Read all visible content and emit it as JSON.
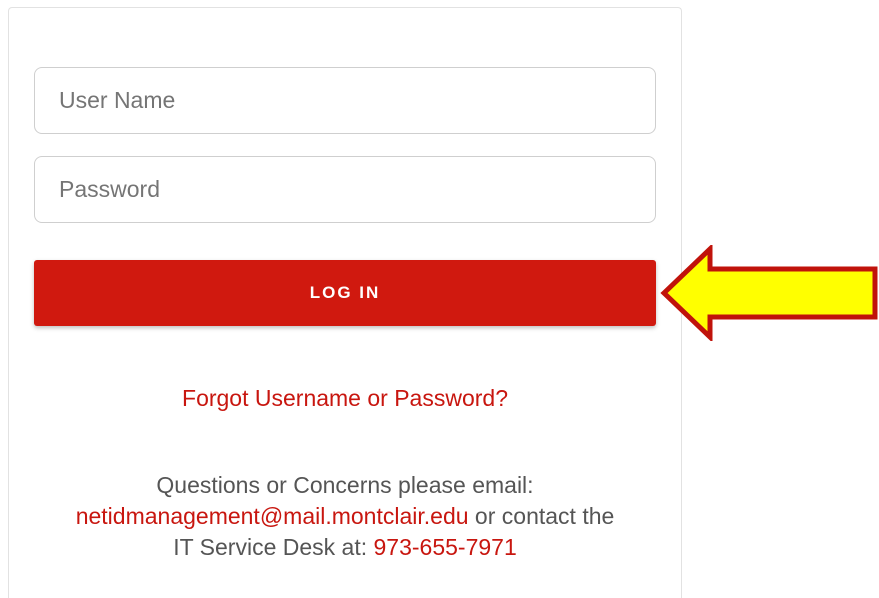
{
  "form": {
    "username_placeholder": "User Name",
    "password_placeholder": "Password",
    "login_label": "LOG IN",
    "forgot_label": "Forgot Username or Password?"
  },
  "contact": {
    "line1": "Questions or Concerns please email:",
    "email": "netidmanagement@mail.montclair.edu",
    "mid_text": " or contact the",
    "line3_prefix": "IT Service Desk at: ",
    "phone": "973-655-7971"
  },
  "annotation": {
    "icon": "arrow-left-icon",
    "fill_color": "#ffff00",
    "stroke_color": "#c0130b"
  },
  "colors": {
    "accent": "#d0190f",
    "link": "#c8160f",
    "text": "#555555"
  }
}
